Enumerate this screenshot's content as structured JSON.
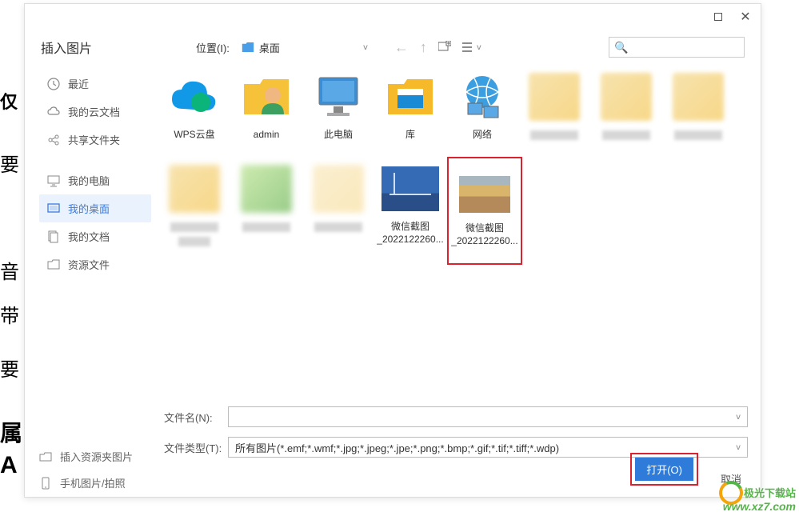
{
  "dialog_title": "插入图片",
  "location": {
    "label": "位置(I):",
    "value": "桌面"
  },
  "sidebar": {
    "recent": "最近",
    "cloud": "我的云文档",
    "shared": "共享文件夹",
    "computer": "我的电脑",
    "desktop": "我的桌面",
    "documents": "我的文档",
    "resources": "资源文件"
  },
  "items": {
    "wps_cloud": "WPS云盘",
    "admin": "admin",
    "this_pc": "此电脑",
    "library": "库",
    "network": "网络",
    "screenshot1_label": "微信截图",
    "screenshot1_date": "_2022122260...",
    "screenshot2_label": "微信截图",
    "screenshot2_date": "_2022122260..."
  },
  "form": {
    "filename_label": "文件名(N):",
    "filetype_label": "文件类型(T):",
    "filetype_value": "所有图片(*.emf;*.wmf;*.jpg;*.jpeg;*.jpe;*.png;*.bmp;*.gif;*.tif;*.tiff;*.wdp)"
  },
  "bottom_actions": {
    "insert_folder": "插入资源夹图片",
    "phone_photo": "手机图片/拍照"
  },
  "buttons": {
    "open": "打开(O)",
    "cancel": "取消"
  },
  "bg": {
    "t1": "仅",
    "t2": "要",
    "t3": "音",
    "t4": "带",
    "t5": "要",
    "t6": "属",
    "t7": "A"
  },
  "watermark": {
    "zh": "极光下载站",
    "url": "www.xz7.com"
  }
}
